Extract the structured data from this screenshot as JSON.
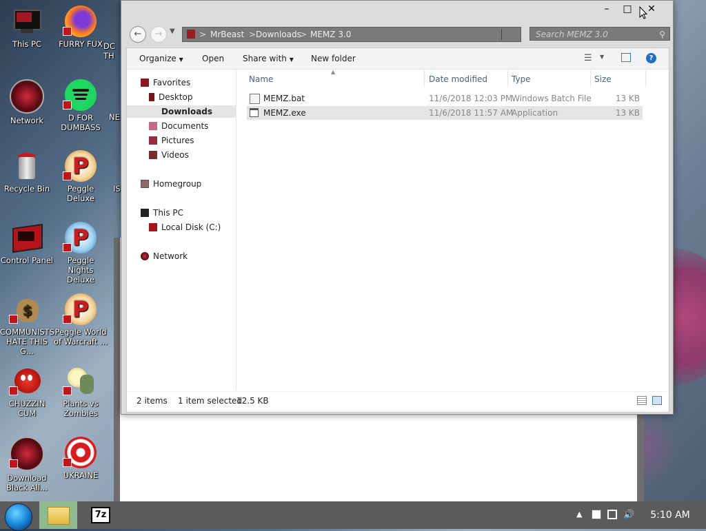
{
  "desktop": {
    "icons": [
      {
        "label": "This PC"
      },
      {
        "label": "FURRY FUX"
      },
      {
        "label": "Network"
      },
      {
        "label": "D FOR DUMBASS"
      },
      {
        "label": "Recycle Bin"
      },
      {
        "label": "Peggle Deluxe"
      },
      {
        "label": "Control Panel"
      },
      {
        "label": "Peggle Nights Deluxe"
      },
      {
        "label": "COMMUNISTS HATE THIS G..."
      },
      {
        "label": "Peggle World of Warcraft ..."
      },
      {
        "label": "CHUZZIN CUM"
      },
      {
        "label": "Plants vs Zombies"
      },
      {
        "label": "Download Black All..."
      },
      {
        "label": "UKRAINE"
      }
    ],
    "partial_icons": [
      "DC TH",
      "NE",
      "IS"
    ]
  },
  "explorer": {
    "window_controls": {
      "minimize": "–",
      "maximize": "□",
      "close": "✕"
    },
    "breadcrumb": [
      "MrBeast",
      "Downloads",
      "MEMZ 3.0"
    ],
    "breadcrumb_sep": ">",
    "search_placeholder": "Search MEMZ 3.0",
    "toolbar": {
      "organize": "Organize",
      "open": "Open",
      "share_with": "Share with",
      "new_folder": "New folder"
    },
    "nav": {
      "favorites": "Favorites",
      "favorites_items": [
        "Desktop",
        "Downloads",
        "Documents",
        "Pictures",
        "Videos"
      ],
      "homegroup": "Homegroup",
      "this_pc": "This PC",
      "local_disk": "Local Disk (C:)",
      "network": "Network"
    },
    "columns": [
      "Name",
      "Date modified",
      "Type",
      "Size"
    ],
    "files": [
      {
        "name": "MEMZ.bat",
        "date": "11/6/2018 12:03 PM",
        "type": "Windows Batch File",
        "size": "13 KB"
      },
      {
        "name": "MEMZ.exe",
        "date": "11/6/2018 11:57 AM",
        "type": "Application",
        "size": "13 KB"
      }
    ],
    "status": {
      "count": "2 items",
      "selected": "1 item selected",
      "size": "12.5 KB"
    }
  },
  "taskbar": {
    "app_7z": "7z",
    "clock": "5:10 AM"
  },
  "colors": {
    "taskbar": "#5b5b5b",
    "selection": "#e5e5e5",
    "shortcut_badge": "#c0161b"
  }
}
